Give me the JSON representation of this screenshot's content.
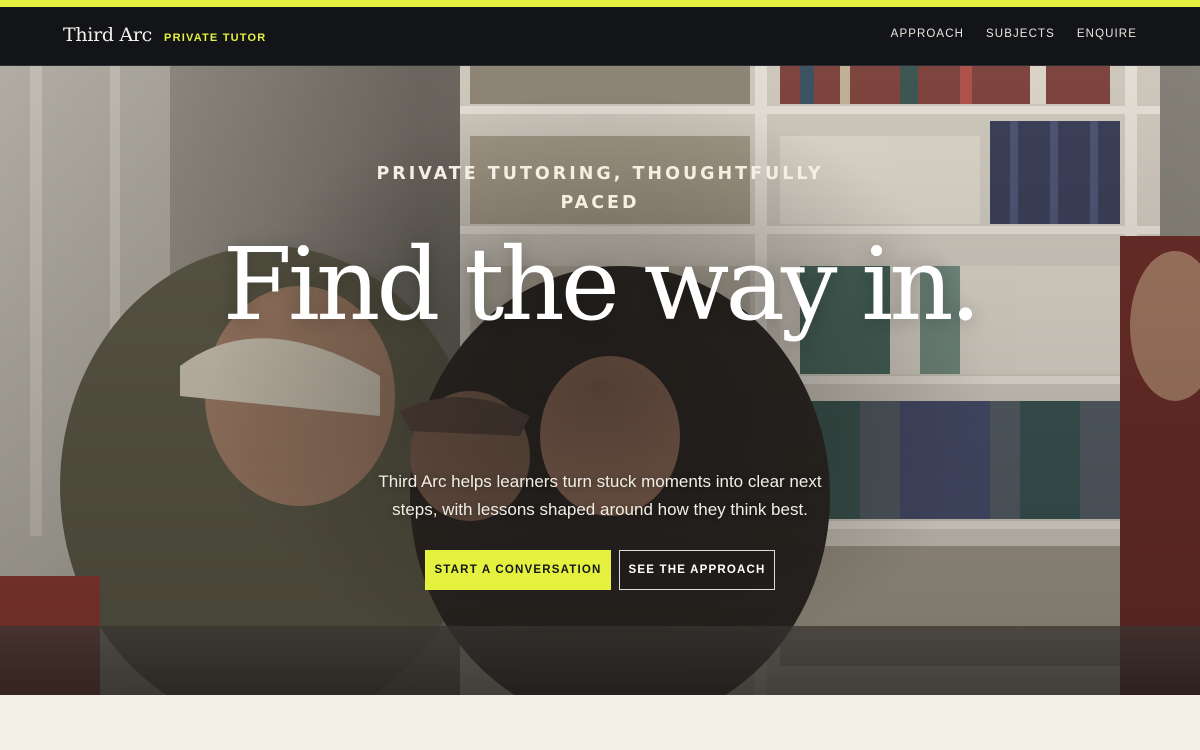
{
  "colors": {
    "accent": "#e4f13f",
    "header_bg": "#121417",
    "page_bg": "#f3f0e8"
  },
  "header": {
    "brand_name": "Third Arc",
    "brand_tag": "PRIVATE TUTOR",
    "nav": [
      {
        "label": "APPROACH"
      },
      {
        "label": "SUBJECTS"
      },
      {
        "label": "ENQUIRE"
      }
    ]
  },
  "hero": {
    "eyebrow": "PRIVATE TUTORING, THOUGHTFULLY PACED",
    "headline": "Find the way in.",
    "lede": "Third Arc helps learners turn stuck moments into clear next steps, with lessons shaped around how they think best.",
    "primary_cta": "START A CONVERSATION",
    "secondary_cta": "SEE THE APPROACH",
    "background_image": "tutoring-library-photo"
  }
}
